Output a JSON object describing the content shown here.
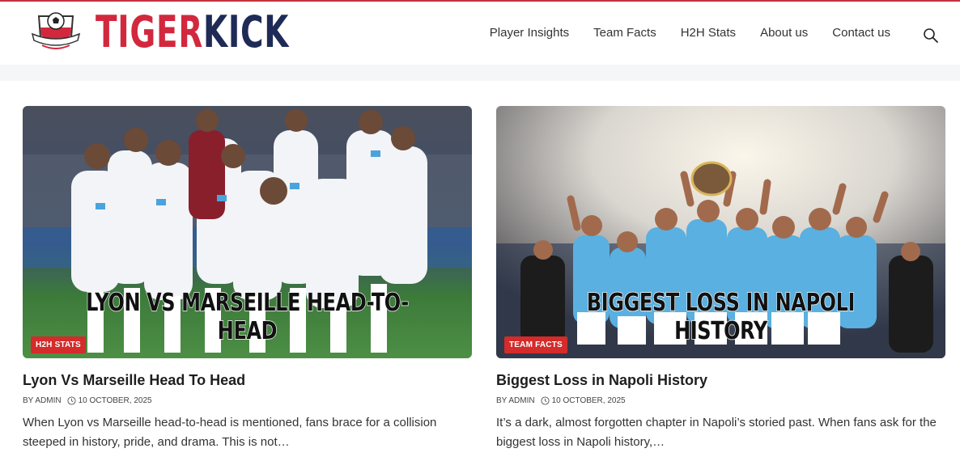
{
  "brand": {
    "part1": "TIGER",
    "part2": "KICK"
  },
  "nav": [
    {
      "label": "Player Insights"
    },
    {
      "label": "Team Facts"
    },
    {
      "label": "H2H Stats"
    },
    {
      "label": "About us"
    },
    {
      "label": "Contact us"
    }
  ],
  "icons": {
    "search": "search-icon",
    "clock": "clock-icon",
    "logo": "football-crest-icon"
  },
  "colors": {
    "brand_red": "#d2283e",
    "brand_navy": "#1f2b56",
    "tag_red": "#d42b2b"
  },
  "posts": [
    {
      "image_caption": "LYON VS MARSEILLE HEAD-TO-HEAD",
      "category": "H2H STATS",
      "title": "Lyon Vs Marseille Head To Head",
      "author": "BY ADMIN",
      "date": "10 OCTOBER, 2025",
      "excerpt": "When Lyon vs Marseille head-to-head is mentioned, fans brace for a collision steeped in history, pride, and drama. This is not…"
    },
    {
      "image_caption": "BIGGEST LOSS IN NAPOLI HISTORY",
      "category": "TEAM FACTS",
      "title": "Biggest Loss in Napoli History",
      "author": "BY ADMIN",
      "date": "10 OCTOBER, 2025",
      "excerpt": "It’s a dark, almost forgotten chapter in Napoli’s storied past. When fans ask for the biggest loss in Napoli history,…"
    }
  ]
}
